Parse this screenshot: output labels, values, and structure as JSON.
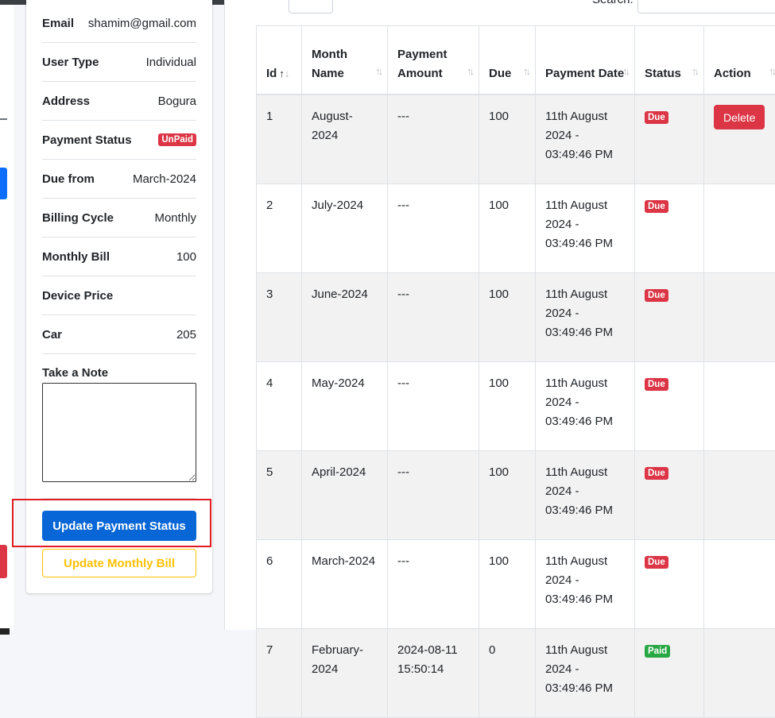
{
  "profile": {
    "rows": [
      {
        "label": "Email",
        "value": "shamim@gmail.com"
      },
      {
        "label": "User Type",
        "value": "Individual"
      },
      {
        "label": "Address",
        "value": "Bogura"
      },
      {
        "label": "Payment Status",
        "badge": "UnPaid"
      },
      {
        "label": "Due from",
        "value": "March-2024"
      },
      {
        "label": "Billing Cycle",
        "value": "Monthly"
      },
      {
        "label": "Monthly Bill",
        "value": "100"
      },
      {
        "label": "Device Price",
        "value": ""
      },
      {
        "label": "Car",
        "value": "205"
      }
    ],
    "note_label": "Take a Note",
    "note_value": "",
    "update_status_label": "Update Payment Status",
    "update_bill_label": "Update Monthly Bill"
  },
  "table": {
    "search_label": "Search:",
    "columns": [
      "Id",
      "Month Name",
      "Payment Amount",
      "Due",
      "Payment Date",
      "Status",
      "Action"
    ],
    "delete_label": "Delete",
    "rows": [
      {
        "id": "1",
        "month": "August-2024",
        "amount": "---",
        "due": "100",
        "date": "11th August 2024 - 03:49:46 PM",
        "status": "Due",
        "action": "Delete"
      },
      {
        "id": "2",
        "month": "July-2024",
        "amount": "---",
        "due": "100",
        "date": "11th August 2024 - 03:49:46 PM",
        "status": "Due",
        "action": ""
      },
      {
        "id": "3",
        "month": "June-2024",
        "amount": "---",
        "due": "100",
        "date": "11th August 2024 - 03:49:46 PM",
        "status": "Due",
        "action": ""
      },
      {
        "id": "4",
        "month": "May-2024",
        "amount": "---",
        "due": "100",
        "date": "11th August 2024 - 03:49:46 PM",
        "status": "Due",
        "action": ""
      },
      {
        "id": "5",
        "month": "April-2024",
        "amount": "---",
        "due": "100",
        "date": "11th August 2024 - 03:49:46 PM",
        "status": "Due",
        "action": ""
      },
      {
        "id": "6",
        "month": "March-2024",
        "amount": "---",
        "due": "100",
        "date": "11th August 2024 - 03:49:46 PM",
        "status": "Due",
        "action": ""
      },
      {
        "id": "7",
        "month": "February-2024",
        "amount": "2024-08-11 15:50:14",
        "due": "0",
        "date": "11th August 2024 - 03:49:46 PM",
        "status": "Paid",
        "action": ""
      }
    ]
  },
  "colors": {
    "primary": "#0866d6",
    "danger": "#dc3545",
    "success": "#28a745",
    "warning": "#ffc107",
    "highlight": "#e11b22"
  }
}
